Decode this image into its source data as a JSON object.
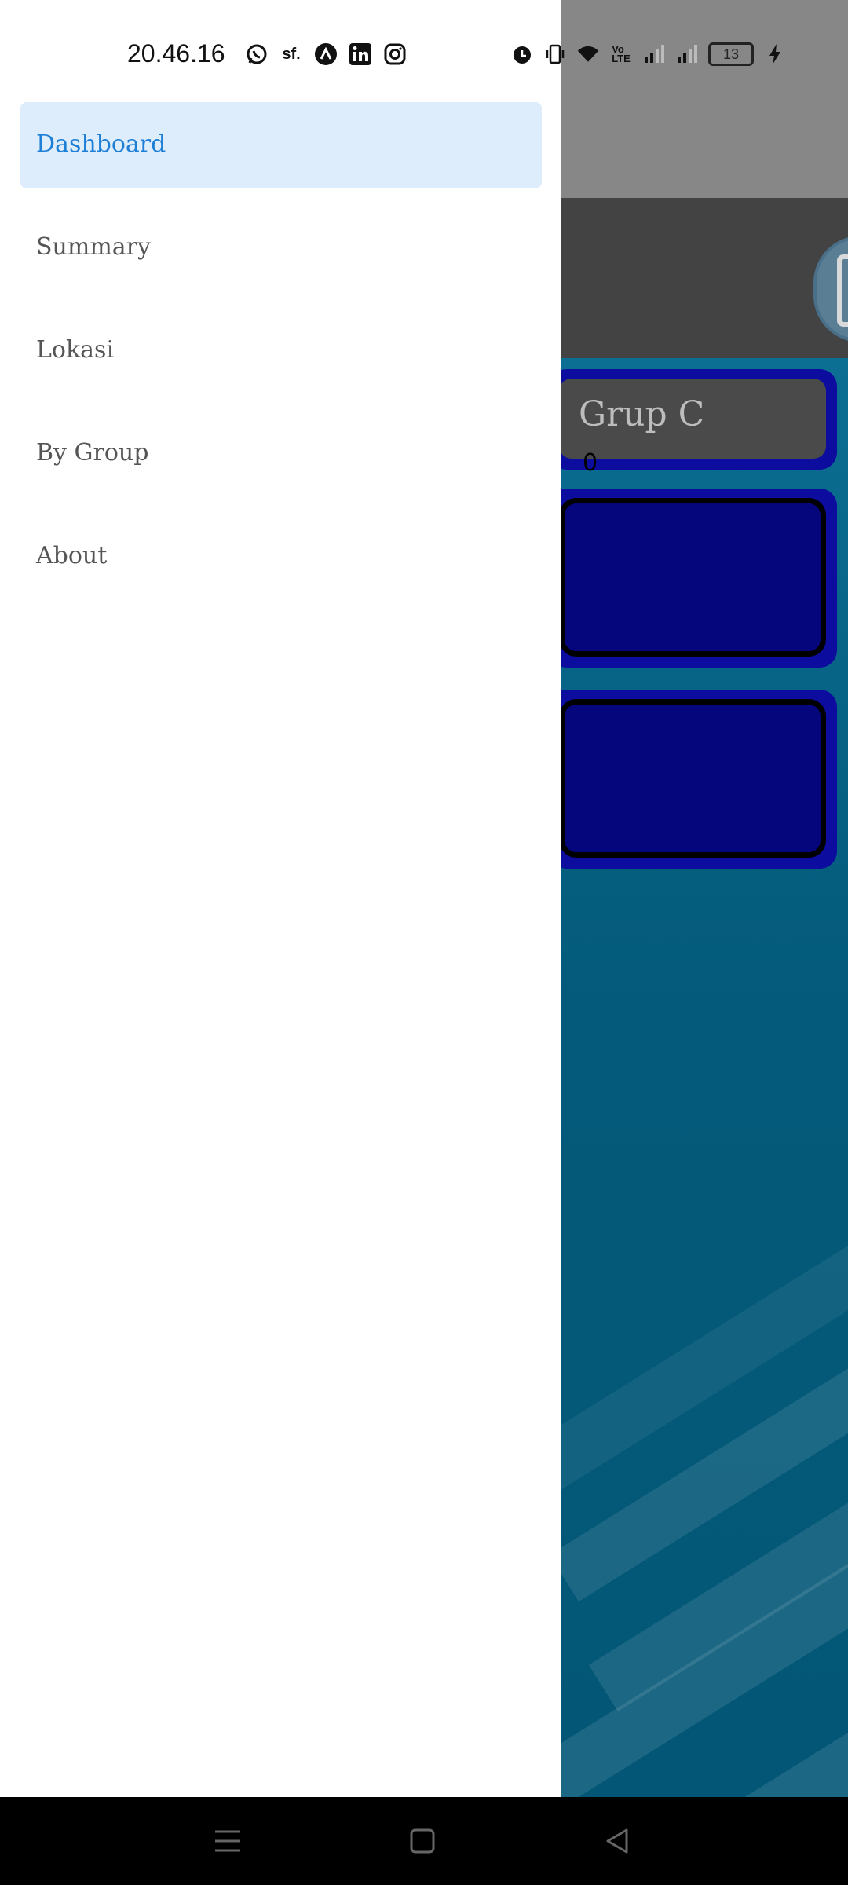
{
  "status_bar": {
    "time": "20.46.16",
    "notification_icons": [
      "whatsapp-icon",
      "sf-app-icon",
      "arc-app-icon",
      "linkedin-icon",
      "instagram-icon"
    ],
    "system_icons": [
      "alarm-icon",
      "vibrate-icon",
      "wifi-icon",
      "volte-icon",
      "signal-icon",
      "signal-icon"
    ],
    "battery_level": "13",
    "charging": true
  },
  "drawer": {
    "items": [
      {
        "label": "Dashboard",
        "active": true
      },
      {
        "label": "Summary",
        "active": false
      },
      {
        "label": "Lokasi",
        "active": false
      },
      {
        "label": "By Group",
        "active": false
      },
      {
        "label": "About",
        "active": false
      }
    ],
    "active_color": "#1e7fd6",
    "active_bg": "#deedfc"
  },
  "background_app": {
    "cards": [
      {
        "title": "Grup C",
        "value": "0"
      },
      {
        "title": "",
        "value": ""
      },
      {
        "title": "",
        "value": ""
      }
    ]
  },
  "nav_bar": {
    "buttons": [
      "menu-icon",
      "home-icon",
      "back-icon"
    ]
  }
}
